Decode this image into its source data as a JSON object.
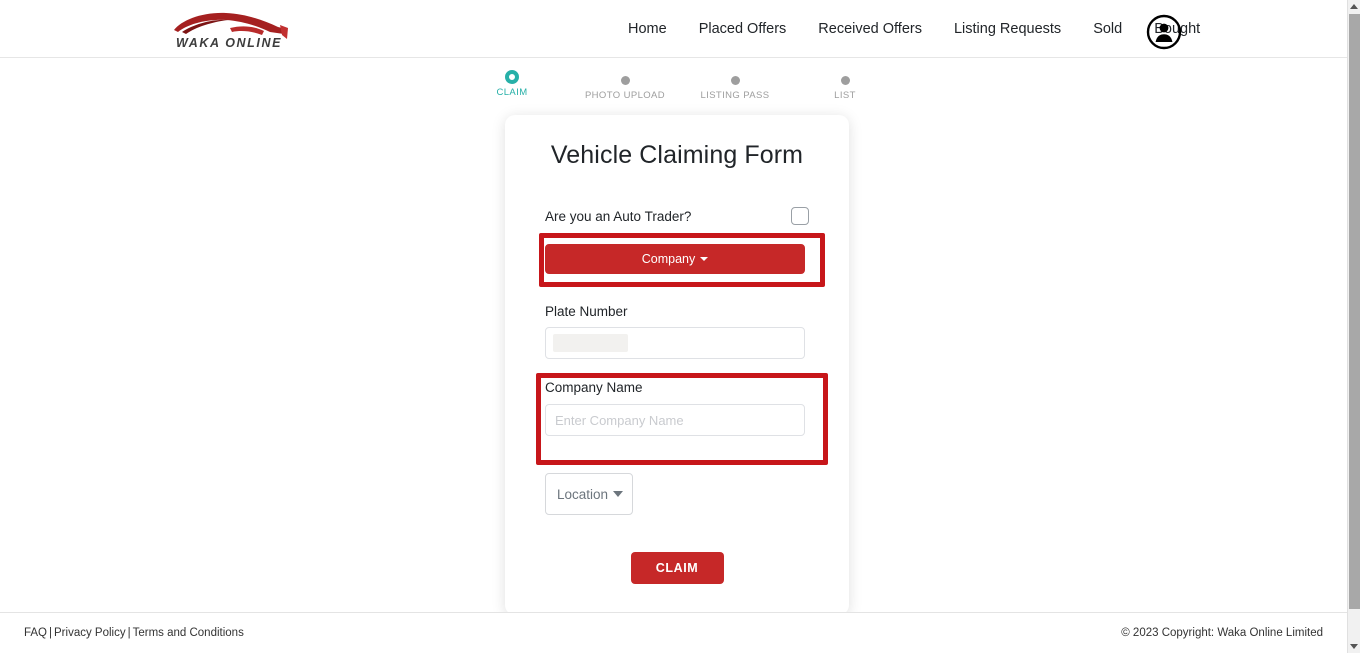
{
  "header": {
    "brand_name": "WAKA ONLINE",
    "nav_items": [
      {
        "label": "Home"
      },
      {
        "label": "Placed Offers"
      },
      {
        "label": "Received Offers"
      },
      {
        "label": "Listing Requests"
      },
      {
        "label": "Sold"
      },
      {
        "label": "Bought"
      }
    ],
    "account_icon": "account-circle-icon"
  },
  "stepper": {
    "steps": [
      {
        "label": "CLAIM",
        "state": "active"
      },
      {
        "label": "PHOTO UPLOAD",
        "state": "inactive"
      },
      {
        "label": "LISTING PASS",
        "state": "inactive"
      },
      {
        "label": "LIST",
        "state": "inactive"
      }
    ],
    "active_color": "#27b0a8",
    "inactive_color": "#9e9e9e"
  },
  "form": {
    "title": "Vehicle Claiming Form",
    "auto_trader_question": "Are you an Auto Trader?",
    "auto_trader_checked": false,
    "company_dropdown_label": "Company",
    "plate_number_label": "Plate Number",
    "plate_number_value": "",
    "plate_number_placeholder": "",
    "company_name_label": "Company Name",
    "company_name_value": "",
    "company_name_placeholder": "Enter Company Name",
    "location_label": "Location",
    "submit_label": "CLAIM",
    "primary_color": "#c62828"
  },
  "annotations": {
    "color": "#c7161a",
    "boxes": [
      {
        "target": "company-dropdown"
      },
      {
        "target": "company-name-field"
      }
    ]
  },
  "footer": {
    "link_faq": "FAQ",
    "link_privacy": "Privacy Policy",
    "link_terms": "Terms and Conditions",
    "separator": "|",
    "copyright": "© 2023 Copyright: Waka Online Limited"
  }
}
